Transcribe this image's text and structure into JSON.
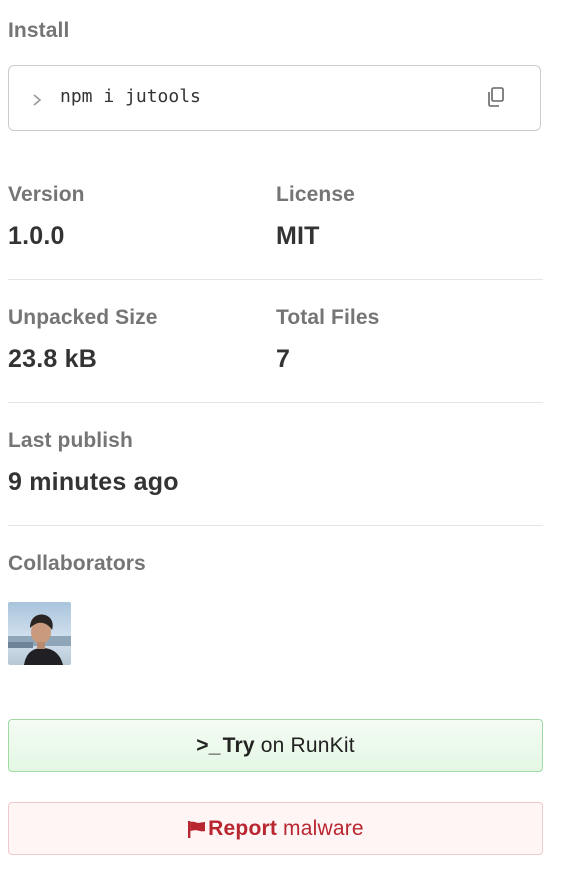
{
  "install": {
    "label": "Install",
    "command": "npm i jutools",
    "prompt_icon": "chevron-right-icon",
    "copy_icon": "copy-icon"
  },
  "stats": {
    "version": {
      "label": "Version",
      "value": "1.0.0"
    },
    "license": {
      "label": "License",
      "value": "MIT"
    },
    "unpacked_size": {
      "label": "Unpacked Size",
      "value": "23.8 kB"
    },
    "total_files": {
      "label": "Total Files",
      "value": "7"
    },
    "last_publish": {
      "label": "Last publish",
      "value": "9 minutes ago"
    }
  },
  "collaborators": {
    "label": "Collaborators",
    "avatar_icon": "user-avatar"
  },
  "runkit_button": {
    "prefix": ">_",
    "strong": "Try",
    "rest": "on RunKit"
  },
  "report_button": {
    "icon": "flag-icon",
    "strong": "Report",
    "rest": "malware"
  },
  "colors": {
    "label_gray": "#757575",
    "text_dark": "#333333",
    "runkit_border": "#a2d9a4",
    "report_red": "#b8262f"
  }
}
